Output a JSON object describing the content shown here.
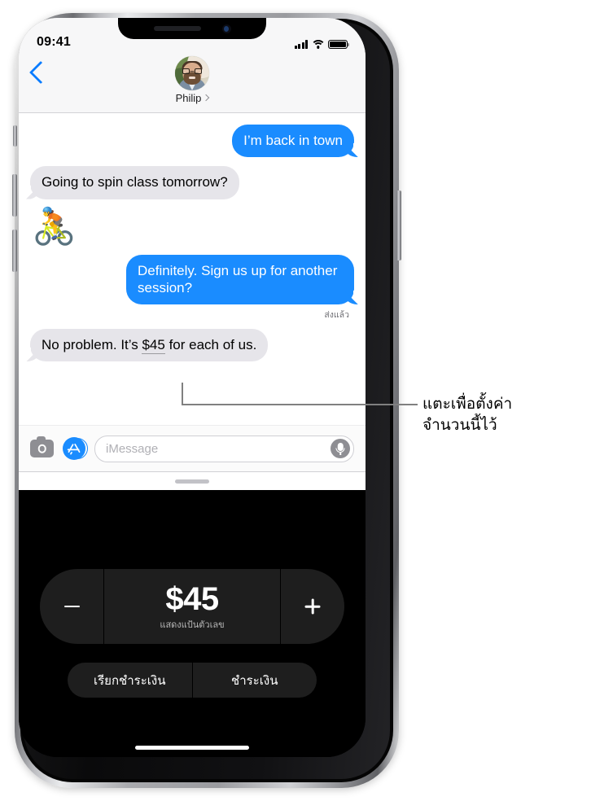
{
  "status_bar": {
    "time": "09:41",
    "signal_icon": "cellular-signal-icon",
    "wifi_icon": "wifi-icon",
    "battery_icon": "battery-full-icon"
  },
  "navbar": {
    "back_icon": "back-chevron-icon",
    "contact_name": "Philip",
    "contact_chevron_icon": "chevron-right-icon",
    "avatar_label": "avatar"
  },
  "conversation": {
    "messages": [
      {
        "id": "msg1",
        "direction": "out",
        "text": "I’m back in town"
      },
      {
        "id": "msg2",
        "direction": "in",
        "text": "Going to spin class tomorrow?"
      },
      {
        "id": "msg3",
        "direction": "in",
        "type": "emoji",
        "text": "🚴"
      },
      {
        "id": "msg4",
        "direction": "out",
        "text": "Definitely. Sign us up for another session?"
      },
      {
        "id": "msg5",
        "direction": "in",
        "text_before": "No problem. It’s ",
        "amount": "$45",
        "text_after": " for each of us."
      }
    ],
    "delivery_status": "ส่งแล้ว"
  },
  "input_bar": {
    "camera_icon": "camera-icon",
    "appstore_icon": "app-store-icon",
    "placeholder": "iMessage",
    "mic_icon": "microphone-icon"
  },
  "drawer": {
    "grabber": "drawer-grabber"
  },
  "apple_pay": {
    "minus_label": "−",
    "plus_label": "+",
    "amount": "$45",
    "subtitle": "แสดงแป้นตัวเลข",
    "request_label": "เรียกชำระเงิน",
    "pay_label": "ชำระเงิน"
  },
  "callout": {
    "text_line1": "แตะเพื่อตั้งค่า",
    "text_line2": "จำนวนนี้ไว้"
  },
  "colors": {
    "bubble_out": "#1a8cff",
    "bubble_in": "#e6e5ea",
    "accent_blue": "#0a7cff",
    "panel_bg": "#000000",
    "segment_bg": "#1e1e1e",
    "callout_line": "#808080"
  }
}
